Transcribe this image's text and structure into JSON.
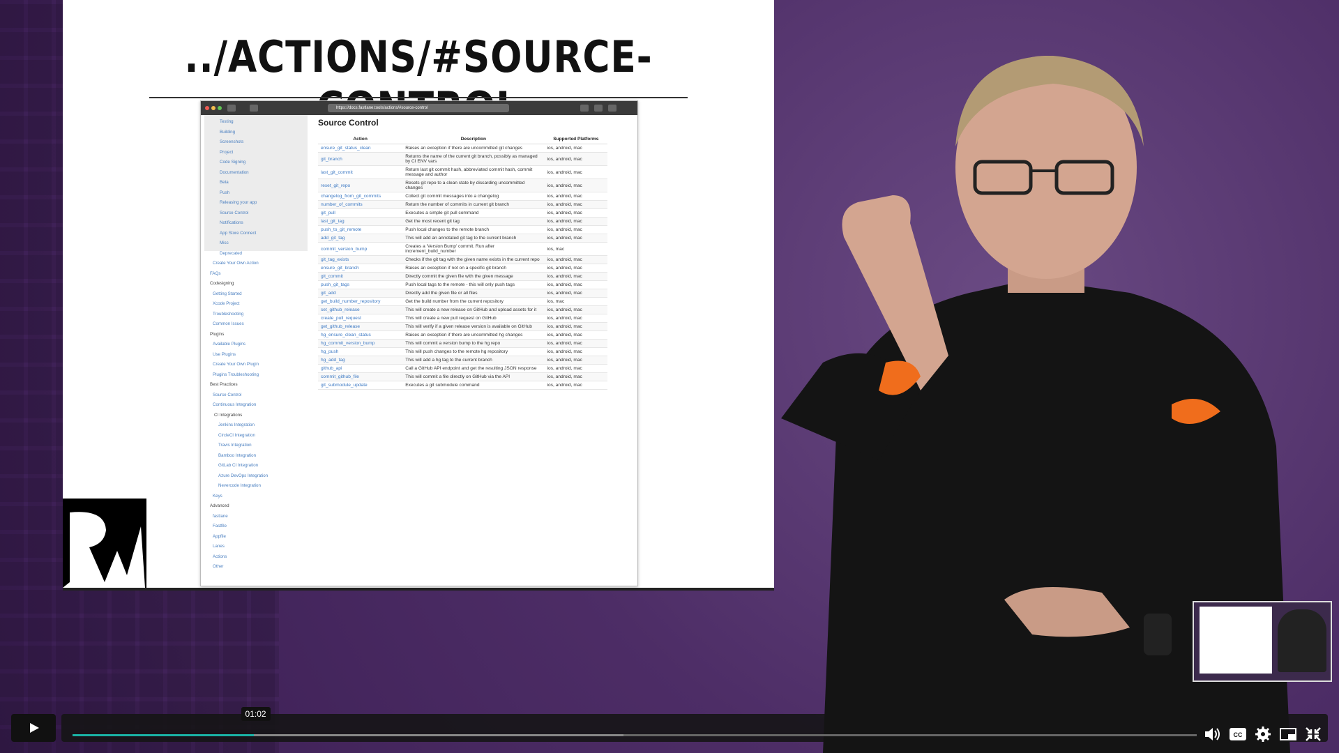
{
  "slide": {
    "title": "../ACTIONS/#SOURCE-CONTROL"
  },
  "browser": {
    "url": "https://docs.fastlane.tools/actions/#source-control",
    "sidebar": [
      "Testing",
      "Building",
      "Screenshots",
      "Project",
      "Code Signing",
      "Documentation",
      "Beta",
      "Push",
      "Releasing your app",
      "Source Control",
      "Notifications",
      "App Store Connect",
      "Misc",
      "Deprecated",
      "Create Your Own Action",
      "FAQs",
      "Codesigning",
      "Getting Started",
      "Xcode Project",
      "Troubleshooting",
      "Common Issues",
      "Plugins",
      "Available Plugins",
      "Use Plugins",
      "Create Your Own Plugin",
      "Plugins Troubleshooting",
      "Best Practices",
      "Source Control",
      "Continuous Integration",
      "CI Integrations",
      "Jenkins Integration",
      "CircleCI Integration",
      "Travis Integration",
      "Bamboo Integration",
      "GitLab CI Integration",
      "Azure DevOps Integration",
      "Nevercode Integration",
      "Keys",
      "Advanced",
      "fastlane",
      "Fastfile",
      "Appfile",
      "Lanes",
      "Actions",
      "Other"
    ],
    "heading": "Source Control",
    "columns": [
      "Action",
      "Description",
      "Supported Platforms"
    ],
    "rows": [
      [
        "ensure_git_status_clean",
        "Raises an exception if there are uncommitted git changes",
        "ios, android, mac"
      ],
      [
        "git_branch",
        "Returns the name of the current git branch, possibly as managed by CI ENV vars",
        "ios, android, mac"
      ],
      [
        "last_git_commit",
        "Return last git commit hash, abbreviated commit hash, commit message and author",
        "ios, android, mac"
      ],
      [
        "reset_git_repo",
        "Resets git repo to a clean state by discarding uncommitted changes",
        "ios, android, mac"
      ],
      [
        "changelog_from_git_commits",
        "Collect git commit messages into a changelog",
        "ios, android, mac"
      ],
      [
        "number_of_commits",
        "Return the number of commits in current git branch",
        "ios, android, mac"
      ],
      [
        "git_pull",
        "Executes a simple git pull command",
        "ios, android, mac"
      ],
      [
        "last_git_tag",
        "Get the most recent git tag",
        "ios, android, mac"
      ],
      [
        "push_to_git_remote",
        "Push local changes to the remote branch",
        "ios, android, mac"
      ],
      [
        "add_git_tag",
        "This will add an annotated git tag to the current branch",
        "ios, android, mac"
      ],
      [
        "commit_version_bump",
        "Creates a 'Version Bump' commit. Run after increment_build_number",
        "ios, mac"
      ],
      [
        "git_tag_exists",
        "Checks if the git tag with the given name exists in the current repo",
        "ios, android, mac"
      ],
      [
        "ensure_git_branch",
        "Raises an exception if not on a specific git branch",
        "ios, android, mac"
      ],
      [
        "git_commit",
        "Directly commit the given file with the given message",
        "ios, android, mac"
      ],
      [
        "push_git_tags",
        "Push local tags to the remote - this will only push tags",
        "ios, android, mac"
      ],
      [
        "git_add",
        "Directly add the given file or all files",
        "ios, android, mac"
      ],
      [
        "get_build_number_repository",
        "Get the build number from the current repository",
        "ios, mac"
      ],
      [
        "set_github_release",
        "This will create a new release on GitHub and upload assets for it",
        "ios, android, mac"
      ],
      [
        "create_pull_request",
        "This will create a new pull request on GitHub",
        "ios, android, mac"
      ],
      [
        "get_github_release",
        "This will verify if a given release version is available on GitHub",
        "ios, android, mac"
      ],
      [
        "hg_ensure_clean_status",
        "Raises an exception if there are uncommitted hg changes",
        "ios, android, mac"
      ],
      [
        "hg_commit_version_bump",
        "This will commit a version bump to the hg repo",
        "ios, android, mac"
      ],
      [
        "hg_push",
        "This will push changes to the remote hg repository",
        "ios, android, mac"
      ],
      [
        "hg_add_tag",
        "This will add a hg tag to the current branch",
        "ios, android, mac"
      ],
      [
        "github_api",
        "Call a GitHub API endpoint and get the resulting JSON response",
        "ios, android, mac"
      ],
      [
        "commit_github_file",
        "This will commit a file directly on GitHub via the API",
        "ios, android, mac"
      ],
      [
        "git_submodule_update",
        "Executes a git submodule command",
        "ios, android, mac"
      ]
    ]
  },
  "player": {
    "current_time": "01:02",
    "progress": 0.161,
    "buffered": 0.49,
    "icons": [
      "play-icon",
      "volume-icon",
      "captions-icon",
      "settings-icon",
      "pip-icon",
      "fullscreen-exit-icon"
    ],
    "accent": "#1ab3a6"
  }
}
